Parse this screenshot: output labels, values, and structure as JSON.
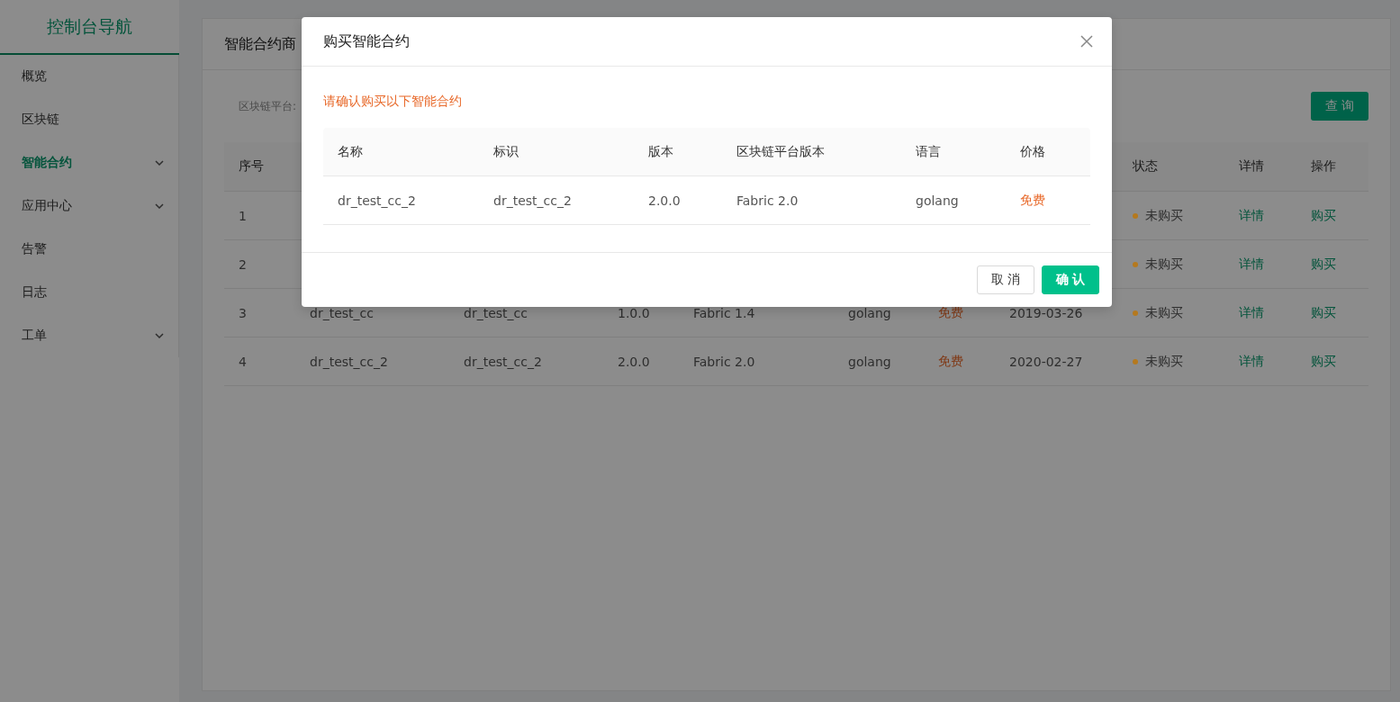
{
  "sidebar": {
    "title": "控制台导航",
    "items": [
      {
        "label": "概览",
        "selected": false,
        "expandable": false
      },
      {
        "label": "区块链",
        "selected": false,
        "expandable": false
      },
      {
        "label": "智能合约",
        "selected": true,
        "expandable": true
      },
      {
        "label": "应用中心",
        "selected": false,
        "expandable": true
      },
      {
        "label": "告警",
        "selected": false,
        "expandable": false
      },
      {
        "label": "日志",
        "selected": false,
        "expandable": false
      },
      {
        "label": "工单",
        "selected": false,
        "expandable": true
      }
    ]
  },
  "page": {
    "title": "智能合约商",
    "filter_label": "区块链平台:",
    "query_button": "查 询",
    "table": {
      "columns": [
        "序号",
        "状态",
        "详情",
        "操作"
      ],
      "rows": [
        {
          "index": "1",
          "status": "未购买",
          "color": "#b5791e",
          "detail": "详情",
          "action": "购买"
        },
        {
          "index": "2",
          "status": "未购买",
          "color": "#b5791e",
          "detail": "详情",
          "action": "购买"
        },
        {
          "index": "3",
          "cells": [
            "dr_test_cc",
            "dr_test_cc",
            "1.0.0",
            "Fabric 1.4",
            "golang"
          ],
          "price": "免费",
          "date": "2019-03-26",
          "status": "未购买",
          "color": "#b5791e",
          "detail": "详情",
          "action": "购买"
        },
        {
          "index": "4",
          "cells": [
            "dr_test_cc_2",
            "dr_test_cc_2",
            "2.0.0",
            "Fabric 2.0",
            "golang"
          ],
          "price": "免费",
          "date": "2020-02-27",
          "status": "未购买",
          "color": "#b5791e",
          "detail": "详情",
          "action": "购买"
        }
      ]
    }
  },
  "dialog": {
    "title": "购买智能合约",
    "notice": "请确认购买以下智能合约",
    "columns": [
      "名称",
      "标识",
      "版本",
      "区块链平台版本",
      "语言",
      "价格"
    ],
    "rows": [
      {
        "cells": [
          "dr_test_cc_2",
          "dr_test_cc_2",
          "2.0.0",
          "Fabric 2.0",
          "golang"
        ],
        "price": "免费"
      }
    ],
    "buttons": [
      {
        "label": "取 消",
        "kind": "secondary"
      },
      {
        "label": "确 认",
        "kind": "primary"
      }
    ]
  }
}
